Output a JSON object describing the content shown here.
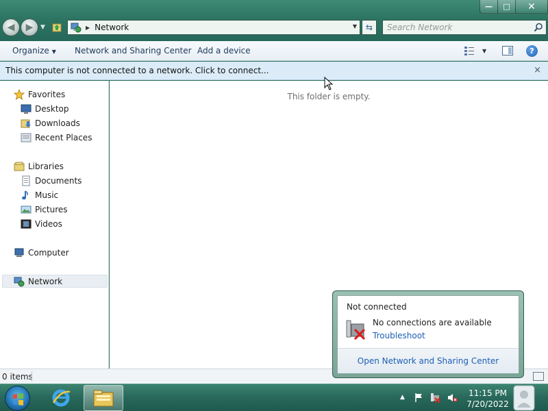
{
  "window": {
    "caption_buttons": {
      "minimize": "—",
      "maximize": "□",
      "close": "✕"
    }
  },
  "address_bar": {
    "location": "Network",
    "location_icon": "network-icon"
  },
  "search": {
    "placeholder": "Search Network"
  },
  "command_bar": {
    "organize": "Organize",
    "network_sharing_center": "Network and Sharing Center",
    "add_device": "Add a device",
    "help": "?"
  },
  "info_bar": {
    "message": "This computer is not connected to a network. Click to connect...",
    "close": "×"
  },
  "nav_pane": {
    "favorites": {
      "label": "Favorites",
      "items": [
        {
          "label": "Desktop",
          "icon": "desktop-icon"
        },
        {
          "label": "Downloads",
          "icon": "downloads-icon"
        },
        {
          "label": "Recent Places",
          "icon": "recent-places-icon"
        }
      ]
    },
    "libraries": {
      "label": "Libraries",
      "items": [
        {
          "label": "Documents",
          "icon": "documents-icon"
        },
        {
          "label": "Music",
          "icon": "music-icon"
        },
        {
          "label": "Pictures",
          "icon": "pictures-icon"
        },
        {
          "label": "Videos",
          "icon": "videos-icon"
        }
      ]
    },
    "computer": {
      "label": "Computer"
    },
    "network": {
      "label": "Network",
      "selected": true
    }
  },
  "content": {
    "empty_message": "This folder is empty."
  },
  "status_bar": {
    "item_count": "0 items"
  },
  "popup": {
    "title": "Not connected",
    "message": "No connections are available",
    "troubleshoot": "Troubleshoot",
    "footer_link": "Open Network and Sharing Center"
  },
  "taskbar": {
    "time": "11:15 PM",
    "date": "7/20/2022",
    "pinned": [
      "internet-explorer-icon",
      "windows-explorer-icon"
    ],
    "tray": [
      "flag-icon",
      "network-disconnected-icon",
      "volume-muted-icon"
    ]
  },
  "colors": {
    "glass": "#2d7562",
    "info_bar": "#dbecf8",
    "link": "#1c5fb5"
  }
}
